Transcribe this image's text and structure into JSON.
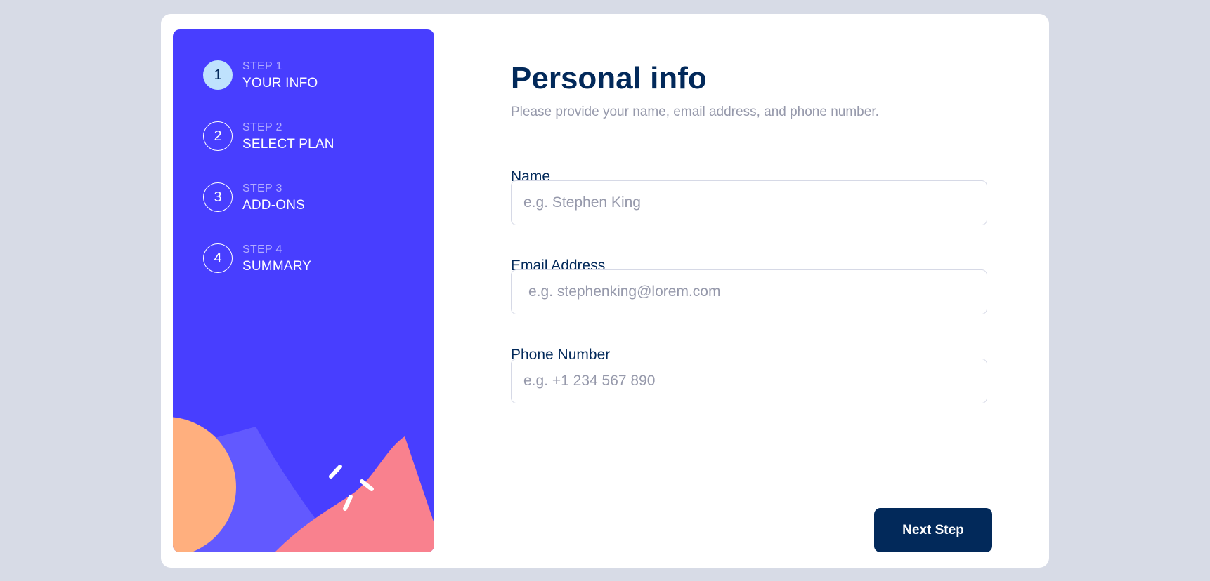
{
  "colors": {
    "page_background": "#d7dbe6",
    "card_background": "#ffffff",
    "sidebar_background": "#483eff",
    "active_step": "#bfe2fd",
    "primary_text": "#02295a",
    "muted_text": "#9699ab",
    "border": "#d6d9e6",
    "accent_orange": "#ffaf7e",
    "accent_pink": "#f9818e",
    "accent_purple": "#6259ff"
  },
  "sidebar": {
    "steps": [
      {
        "number": "1",
        "label": "STEP 1",
        "title": "YOUR INFO",
        "active": true
      },
      {
        "number": "2",
        "label": "STEP 2",
        "title": "SELECT PLAN",
        "active": false
      },
      {
        "number": "3",
        "label": "STEP 3",
        "title": "ADD-ONS",
        "active": false
      },
      {
        "number": "4",
        "label": "STEP 4",
        "title": "SUMMARY",
        "active": false
      }
    ]
  },
  "main": {
    "title": "Personal info",
    "subtitle": "Please provide your name, email address, and phone number.",
    "fields": [
      {
        "label": "Name",
        "placeholder": "e.g. Stephen King",
        "value": ""
      },
      {
        "label": "Email Address",
        "placeholder": "e.g. stephenking@lorem.com",
        "value": ""
      },
      {
        "label": "Phone Number",
        "placeholder": "e.g. +1 234 567 890",
        "value": ""
      }
    ],
    "next_button_label": "Next Step"
  }
}
